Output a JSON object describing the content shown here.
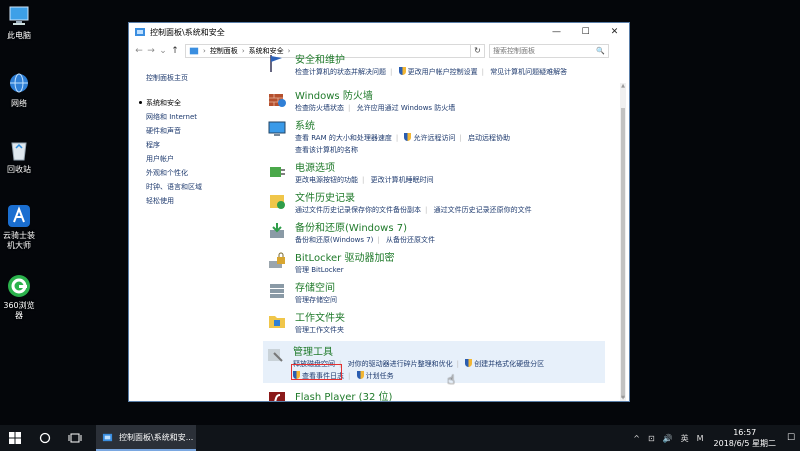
{
  "desktop": {
    "icons": [
      {
        "label": "此电脑",
        "icon": "computer-icon"
      },
      {
        "label": "网络",
        "icon": "network-icon"
      },
      {
        "label": "回收站",
        "icon": "recycle-bin-icon"
      },
      {
        "label": "云骑士装机大师",
        "icon": "knight-app-icon"
      },
      {
        "label": "360浏览器",
        "icon": "360-browser-icon"
      }
    ]
  },
  "window": {
    "title": "控制面板\\系统和安全",
    "controls": {
      "minimize": "—",
      "maximize": "☐",
      "close": "✕"
    },
    "address": {
      "back": "←",
      "forward": "→",
      "dropdown": "⌄",
      "up": "↑",
      "crumbs": [
        "控制面板",
        "系统和安全"
      ],
      "refresh": "↻",
      "search_placeholder": "搜索控制面板",
      "search_icon": "🔍"
    },
    "left_pane": {
      "home": "控制面板主页",
      "items": [
        "系统和安全",
        "网络和 Internet",
        "硬件和声音",
        "程序",
        "用户帐户",
        "外观和个性化",
        "时钟、语言和区域",
        "轻松使用"
      ]
    },
    "categories": [
      {
        "title": "安全和维护",
        "icon": "flag-icon",
        "links": [
          "检查计算机的状态并解决问题",
          "更改用户帐户控制设置",
          "常见计算机问题疑难解答"
        ]
      },
      {
        "title": "Windows 防火墙",
        "icon": "firewall-icon",
        "links": [
          "检查防火墙状态",
          "允许应用通过 Windows 防火墙"
        ]
      },
      {
        "title": "系统",
        "icon": "system-icon",
        "links": [
          "查看 RAM 的大小和处理器速度",
          "允许远程访问",
          "启动远程协助",
          "查看该计算机的名称"
        ]
      },
      {
        "title": "电源选项",
        "icon": "power-icon",
        "links": [
          "更改电源按钮的功能",
          "更改计算机睡眠时间"
        ]
      },
      {
        "title": "文件历史记录",
        "icon": "file-history-icon",
        "links": [
          "通过文件历史记录保存你的文件备份副本",
          "通过文件历史记录还原你的文件"
        ]
      },
      {
        "title": "备份和还原(Windows 7)",
        "icon": "backup-icon",
        "links": [
          "备份和还原(Windows 7)",
          "从备份还原文件"
        ]
      },
      {
        "title": "BitLocker 驱动器加密",
        "icon": "bitlocker-icon",
        "links": [
          "管理 BitLocker"
        ]
      },
      {
        "title": "存储空间",
        "icon": "storage-icon",
        "links": [
          "管理存储空间"
        ]
      },
      {
        "title": "工作文件夹",
        "icon": "work-folders-icon",
        "links": [
          "管理工作文件夹"
        ]
      },
      {
        "title": "管理工具",
        "icon": "admin-tools-icon",
        "links": [
          "释放磁盘空间",
          "对你的驱动器进行碎片整理和优化",
          "创建并格式化硬盘分区",
          "查看事件日志",
          "计划任务"
        ]
      },
      {
        "title": "Flash Player (32 位)",
        "icon": "flash-icon",
        "links": []
      }
    ]
  },
  "taskbar": {
    "start_icon": "windows-start-icon",
    "app_label": "控制面板\\系统和安...",
    "tray": [
      "^",
      "⊡",
      "🔊",
      "英",
      "M"
    ],
    "time": "16:57",
    "date": "2018/6/5 星期二",
    "notification": "☐"
  },
  "colors": {
    "desktop": "#04060a",
    "category_title": "#1f7a2a",
    "link": "#1e3a6e",
    "highlight": "#e7f0fa",
    "red_box": "#e53030"
  }
}
